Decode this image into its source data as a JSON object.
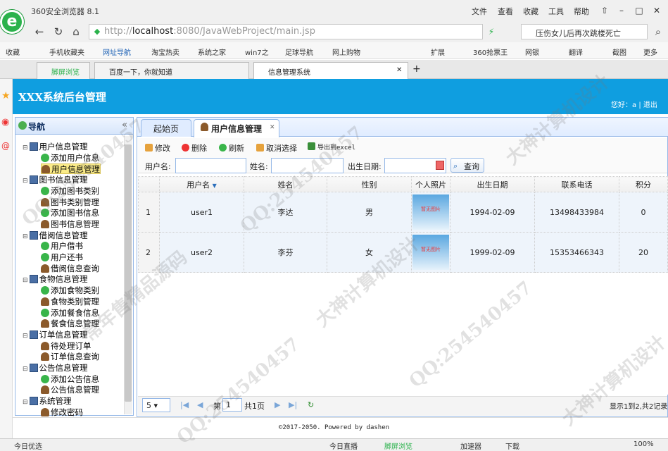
{
  "browser": {
    "title": "360安全浏览器 8.1",
    "menu": [
      "文件",
      "查看",
      "收藏",
      "工具",
      "帮助"
    ],
    "url_prefix": "http://",
    "url_host": "localhost",
    "url_rest": ":8080/JavaWebProject/main.jsp",
    "search_text": "压伤女儿后再次跳楼死亡",
    "bookmarks": [
      "收藏",
      "手机收藏夹",
      "网址导航",
      "淘宝热卖",
      "系统之家",
      "win7之",
      "足球导航",
      "网上购物",
      "扩展",
      "360抢票王",
      "网银",
      "翻译",
      "截图",
      "更多"
    ],
    "tabs": [
      "脚屏浏览",
      "百度一下，你就知道",
      "信息管理系统"
    ]
  },
  "app": {
    "title": "XXX系统后台管理",
    "welcome": "您好：a",
    "logout": "退出"
  },
  "nav": {
    "title": "导航",
    "items": [
      {
        "label": "用户信息管理",
        "level": 0
      },
      {
        "label": "添加用户信息",
        "level": 1,
        "icon": "add"
      },
      {
        "label": "用户信息管理",
        "level": 1,
        "icon": "user",
        "selected": true
      },
      {
        "label": "图书信息管理",
        "level": 0
      },
      {
        "label": "添加图书类别",
        "level": 1,
        "icon": "add"
      },
      {
        "label": "图书类别管理",
        "level": 1,
        "icon": "user"
      },
      {
        "label": "添加图书信息",
        "level": 1,
        "icon": "add"
      },
      {
        "label": "图书信息管理",
        "level": 1,
        "icon": "user"
      },
      {
        "label": "借阅信息管理",
        "level": 0
      },
      {
        "label": "用户借书",
        "level": 1,
        "icon": "add"
      },
      {
        "label": "用户还书",
        "level": 1,
        "icon": "add"
      },
      {
        "label": "借阅信息查询",
        "level": 1,
        "icon": "user"
      },
      {
        "label": "食物信息管理",
        "level": 0
      },
      {
        "label": "添加食物类别",
        "level": 1,
        "icon": "add"
      },
      {
        "label": "食物类别管理",
        "level": 1,
        "icon": "user"
      },
      {
        "label": "添加餐食信息",
        "level": 1,
        "icon": "add"
      },
      {
        "label": "餐食信息管理",
        "level": 1,
        "icon": "user"
      },
      {
        "label": "订单信息管理",
        "level": 0
      },
      {
        "label": "待处理订单",
        "level": 1,
        "icon": "user"
      },
      {
        "label": "订单信息查询",
        "level": 1,
        "icon": "user"
      },
      {
        "label": "公告信息管理",
        "level": 0
      },
      {
        "label": "添加公告信息",
        "level": 1,
        "icon": "add"
      },
      {
        "label": "公告信息管理",
        "level": 1,
        "icon": "user"
      },
      {
        "label": "系统管理",
        "level": 0
      },
      {
        "label": "修改密码",
        "level": 1,
        "icon": "edit"
      }
    ]
  },
  "tabs": {
    "home": "起始页",
    "current": "用户信息管理"
  },
  "toolbar": {
    "edit": "修改",
    "delete": "删除",
    "refresh": "刷新",
    "cancel": "取消选择",
    "export": "导出到excel",
    "label_user": "用户名:",
    "label_name": "姓名:",
    "label_birth": "出生日期:",
    "query": "查询"
  },
  "grid": {
    "headers": [
      "用户名",
      "姓名",
      "性别",
      "个人照片",
      "出生日期",
      "联系电话",
      "积分"
    ],
    "rows": [
      {
        "num": "1",
        "user": "user1",
        "name": "李达",
        "sex": "男",
        "photo": "暂无图片",
        "birth": "1994-02-09",
        "phone": "13498433984",
        "score": "0"
      },
      {
        "num": "2",
        "user": "user2",
        "name": "李芬",
        "sex": "女",
        "photo": "暂无图片",
        "birth": "1999-02-09",
        "phone": "15353466343",
        "score": "20"
      }
    ]
  },
  "pager": {
    "size": "5",
    "page_prefix": "第",
    "page": "1",
    "page_suffix": "共1页",
    "summary": "显示1到2,共2记录"
  },
  "footer": "©2017-2050. Powered by dashen",
  "status": {
    "left": "今日优选",
    "items": [
      "今日直播",
      "脚屏浏览",
      "加速器",
      "下载",
      "100%"
    ]
  },
  "watermarks": [
    "QQ:254540457",
    "常年售精品源码",
    "大神计算机设计"
  ]
}
